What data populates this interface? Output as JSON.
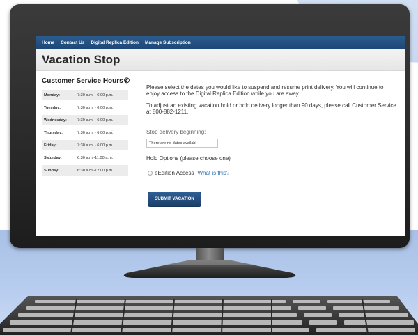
{
  "nav": {
    "items": [
      "Home",
      "Contact Us",
      "Digital Replica Edition",
      "Manage Subscription"
    ]
  },
  "page": {
    "title": "Vacation Stop"
  },
  "hours": {
    "title": "Customer Service Hours",
    "rows": [
      {
        "day": "Monday:",
        "time": "7:30 a.m. - 6:00 p.m."
      },
      {
        "day": "Tuesday:",
        "time": "7:30 a.m. - 6:00 p.m."
      },
      {
        "day": "Wednesday:",
        "time": "7:30 a.m. - 6:00 p.m."
      },
      {
        "day": "Thursday:",
        "time": "7:30 a.m. - 6:00 p.m."
      },
      {
        "day": "Friday:",
        "time": "7:30 a.m. - 6:00 p.m."
      },
      {
        "day": "Saturday:",
        "time": "6:30 a.m.-11:00 a.m."
      },
      {
        "day": "Sunday:",
        "time": "6:30 a.m.-12:00 p.m."
      }
    ]
  },
  "content": {
    "intro": "Please select the dates you would like to suspend and resume print delivery.  You will continue to enjoy access to the Digital Replica Edition while you are away.",
    "adjust": "To adjust an existing vacation hold or hold delivery longer than 90 days, please call Customer Service at 800-882-1211.",
    "stop_label": "Stop delivery beginning:",
    "stop_value": "There are no dates availabl",
    "hold_label": "Hold Options (please choose one)",
    "option_label": "eEdition Access",
    "what_link": "What is this?",
    "submit_label": "SUBMIT VACATION"
  },
  "colors": {
    "nav_bg": "#1d4675",
    "link": "#2e6fb2",
    "button_bg": "#1b3f69",
    "backdrop": "#b8cdef"
  },
  "icons": {
    "phone": "phone-icon"
  }
}
